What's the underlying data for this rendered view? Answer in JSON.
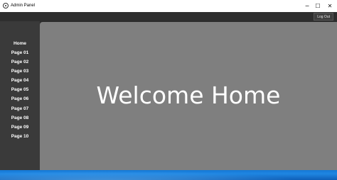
{
  "window": {
    "title": "Admin Panel",
    "minimize_glyph": "─",
    "maximize_glyph": "☐",
    "close_glyph": "✕"
  },
  "toolbar": {
    "logout_label": "Log Out"
  },
  "sidebar": {
    "items": [
      {
        "label": "Home"
      },
      {
        "label": "Page 01"
      },
      {
        "label": "Page 02"
      },
      {
        "label": "Page 03"
      },
      {
        "label": "Page 04"
      },
      {
        "label": "Page 05"
      },
      {
        "label": "Page 06"
      },
      {
        "label": "Page 07"
      },
      {
        "label": "Page 08"
      },
      {
        "label": "Page 09"
      },
      {
        "label": "Page 10"
      }
    ]
  },
  "main": {
    "heading": "Welcome Home"
  },
  "colors": {
    "sidebar_bg": "#3a3a3a",
    "content_bg": "#7f7f7f",
    "titlebar_bg": "#ffffff"
  }
}
